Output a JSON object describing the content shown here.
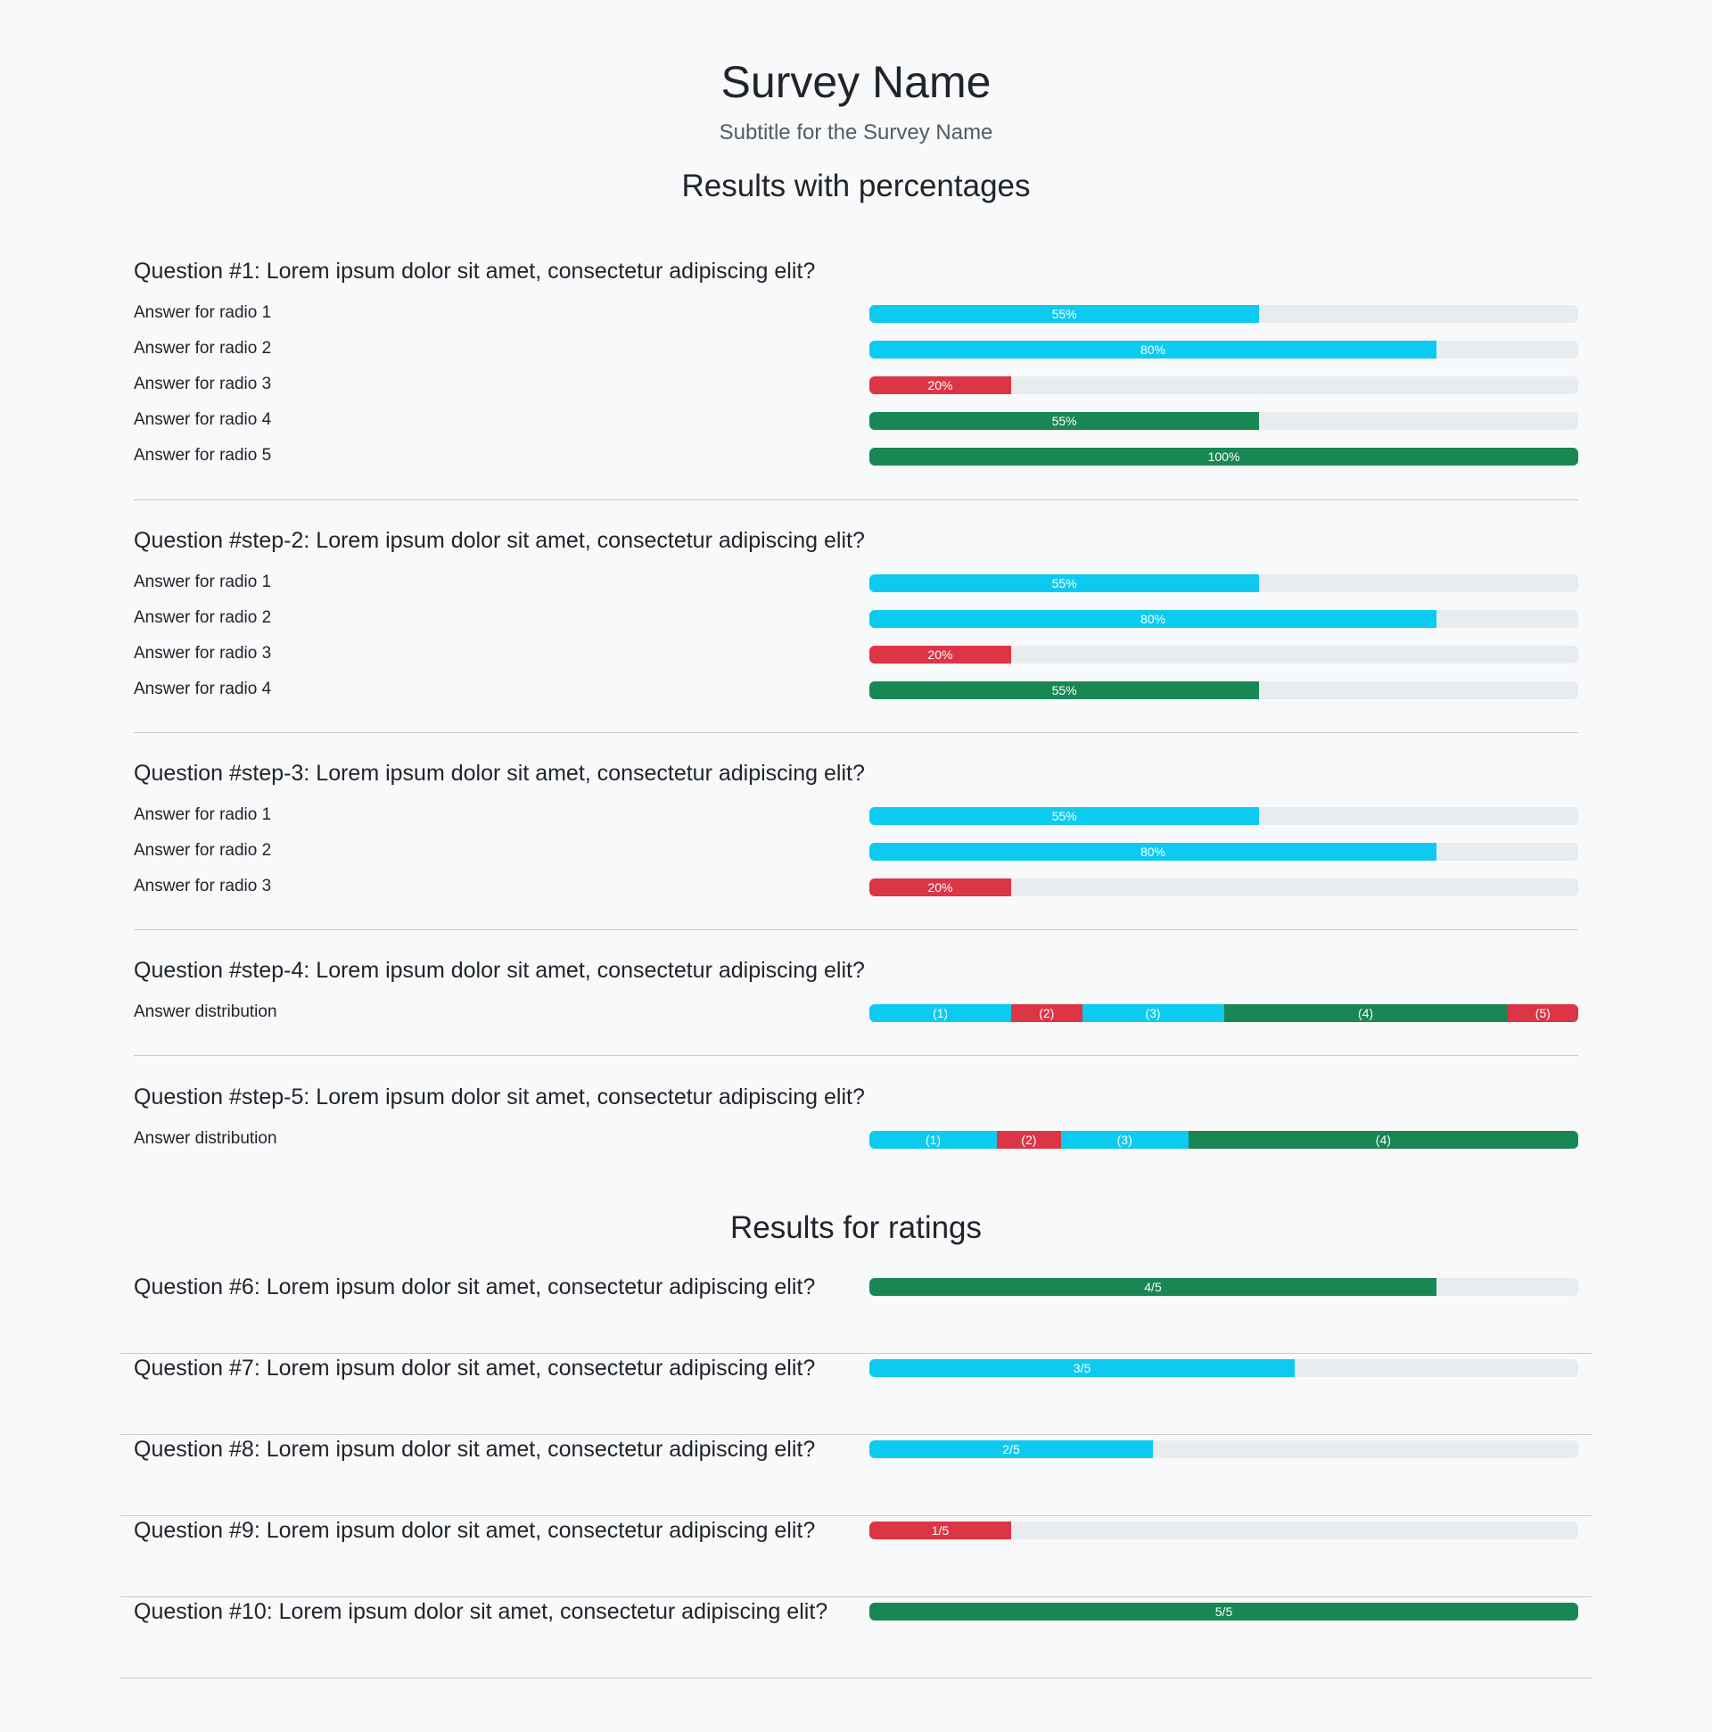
{
  "header": {
    "title": "Survey Name",
    "subtitle": "Subtitle for the Survey Name"
  },
  "percent_section": {
    "title": "Results with percentages",
    "questions": [
      {
        "title": "Question #1: Lorem ipsum dolor sit amet, consectetur adipiscing elit?",
        "answers": [
          {
            "label": "Answer for radio 1",
            "value": 55,
            "text": "55%",
            "color": "#0dcaf0"
          },
          {
            "label": "Answer for radio 2",
            "value": 80,
            "text": "80%",
            "color": "#0dcaf0"
          },
          {
            "label": "Answer for radio 3",
            "value": 20,
            "text": "20%",
            "color": "#dc3545"
          },
          {
            "label": "Answer for radio 4",
            "value": 55,
            "text": "55%",
            "color": "#198754"
          },
          {
            "label": "Answer for radio 5",
            "value": 100,
            "text": "100%",
            "color": "#198754"
          }
        ]
      },
      {
        "title": "Question #step-2: Lorem ipsum dolor sit amet, consectetur adipiscing elit?",
        "answers": [
          {
            "label": "Answer for radio 1",
            "value": 55,
            "text": "55%",
            "color": "#0dcaf0"
          },
          {
            "label": "Answer for radio 2",
            "value": 80,
            "text": "80%",
            "color": "#0dcaf0"
          },
          {
            "label": "Answer for radio 3",
            "value": 20,
            "text": "20%",
            "color": "#dc3545"
          },
          {
            "label": "Answer for radio 4",
            "value": 55,
            "text": "55%",
            "color": "#198754"
          }
        ]
      },
      {
        "title": "Question #step-3: Lorem ipsum dolor sit amet, consectetur adipiscing elit?",
        "answers": [
          {
            "label": "Answer for radio 1",
            "value": 55,
            "text": "55%",
            "color": "#0dcaf0"
          },
          {
            "label": "Answer for radio 2",
            "value": 80,
            "text": "80%",
            "color": "#0dcaf0"
          },
          {
            "label": "Answer for radio 3",
            "value": 20,
            "text": "20%",
            "color": "#dc3545"
          }
        ]
      },
      {
        "title": "Question #step-4: Lorem ipsum dolor sit amet, consectetur adipiscing elit?",
        "distribution": {
          "label": "Answer distribution",
          "segments": [
            {
              "text": "(1)",
              "value": 20,
              "color": "#0dcaf0"
            },
            {
              "text": "(2)",
              "value": 10,
              "color": "#dc3545"
            },
            {
              "text": "(3)",
              "value": 20,
              "color": "#0dcaf0"
            },
            {
              "text": "(4)",
              "value": 40,
              "color": "#198754"
            },
            {
              "text": "(5)",
              "value": 10,
              "color": "#dc3545"
            }
          ]
        }
      },
      {
        "title": "Question #step-5: Lorem ipsum dolor sit amet, consectetur adipiscing elit?",
        "distribution": {
          "label": "Answer distribution",
          "segments": [
            {
              "text": "(1)",
              "value": 18,
              "color": "#0dcaf0"
            },
            {
              "text": "(2)",
              "value": 9,
              "color": "#dc3545"
            },
            {
              "text": "(3)",
              "value": 18,
              "color": "#0dcaf0"
            },
            {
              "text": "(4)",
              "value": 55,
              "color": "#198754"
            }
          ]
        }
      }
    ]
  },
  "ratings_section": {
    "title": "Results for ratings",
    "items": [
      {
        "title": "Question #6: Lorem ipsum dolor sit amet, consectetur adipiscing elit?",
        "text": "4/5",
        "value": 4,
        "max": 5,
        "color": "#198754"
      },
      {
        "title": "Question #7: Lorem ipsum dolor sit amet, consectetur adipiscing elit?",
        "text": "3/5",
        "value": 3,
        "max": 5,
        "color": "#0dcaf0"
      },
      {
        "title": "Question #8: Lorem ipsum dolor sit amet, consectetur adipiscing elit?",
        "text": "2/5",
        "value": 2,
        "max": 5,
        "color": "#0dcaf0"
      },
      {
        "title": "Question #9: Lorem ipsum dolor sit amet, consectetur adipiscing elit?",
        "text": "1/5",
        "value": 1,
        "max": 5,
        "color": "#dc3545"
      },
      {
        "title": "Question #10: Lorem ipsum dolor sit amet, consectetur adipiscing elit?",
        "text": "5/5",
        "value": 5,
        "max": 5,
        "color": "#198754"
      }
    ]
  }
}
